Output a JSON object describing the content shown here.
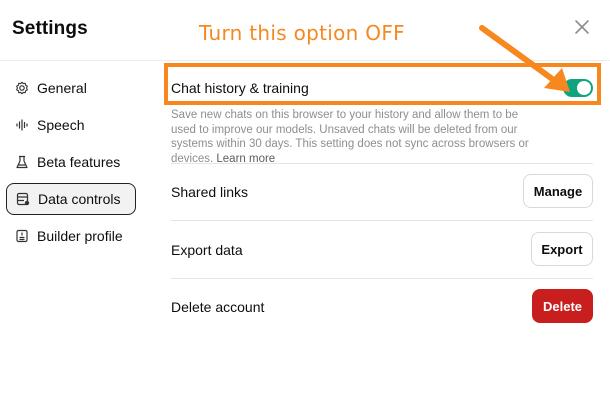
{
  "header": {
    "title": "Settings",
    "close_icon": "close-icon"
  },
  "sidebar": {
    "items": [
      {
        "label": "General",
        "icon": "gear-icon",
        "active": false
      },
      {
        "label": "Speech",
        "icon": "waveform-icon",
        "active": false
      },
      {
        "label": "Beta features",
        "icon": "flask-icon",
        "active": false
      },
      {
        "label": "Data controls",
        "icon": "database-icon",
        "active": true
      },
      {
        "label": "Builder profile",
        "icon": "id-card-icon",
        "active": false
      }
    ]
  },
  "main": {
    "chat_history": {
      "label": "Chat history & training",
      "toggle_on": true,
      "description": "Save new chats on this browser to your history and allow them to be used to improve our models. Unsaved chats will be deleted from our systems within 30 days. This setting does not sync across browsers or devices.",
      "learn_more": "Learn more"
    },
    "shared_links": {
      "label": "Shared links",
      "button": "Manage"
    },
    "export_data": {
      "label": "Export data",
      "button": "Export"
    },
    "delete_account": {
      "label": "Delete account",
      "button": "Delete"
    }
  },
  "annotation": {
    "text": "Turn this option OFF",
    "color": "#f7881f"
  },
  "colors": {
    "toggle_on": "#10a37f",
    "danger": "#c81e1e",
    "annotation": "#f7881f"
  }
}
